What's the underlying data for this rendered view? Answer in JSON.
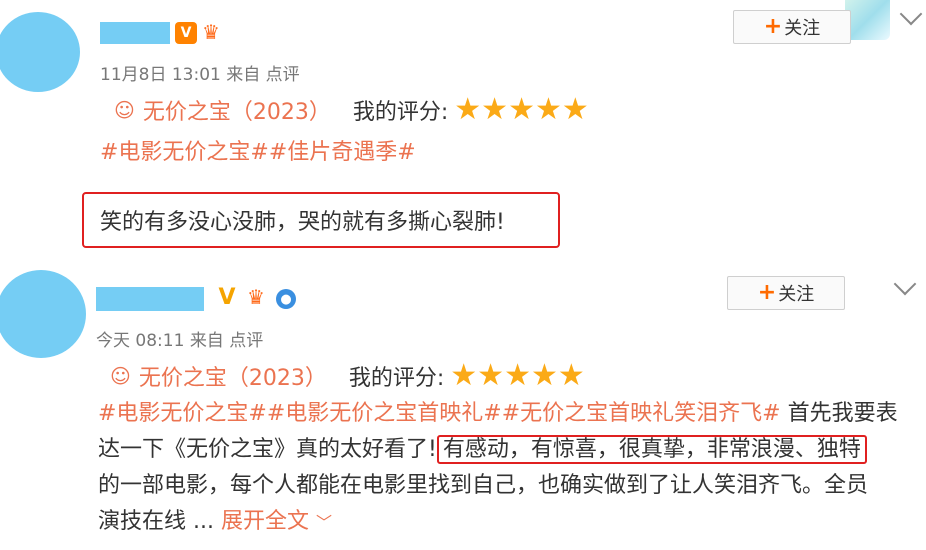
{
  "posts": [
    {
      "timestamp": "11月8日 13:01",
      "source": "来自 点评",
      "follow_label": "关注",
      "follow_plus": "+",
      "movie_title": "无价之宝（2023）",
      "rating_label": "我的评分:",
      "stars": "★★★★★",
      "stars_value": 5,
      "hashtags": "#电影无价之宝##佳片奇遇季#",
      "quote": "笑的有多没心没肺，哭的就有多撕心裂肺!"
    },
    {
      "timestamp": "今天 08:11",
      "source": "来自 点评",
      "follow_label": "关注",
      "follow_plus": "+",
      "movie_title": "无价之宝（2023）",
      "rating_label": "我的评分:",
      "stars": "★★★★★",
      "stars_value": 5,
      "hashtags": "#电影无价之宝##电影无价之宝首映礼##无价之宝首映礼笑泪齐飞#",
      "body_line1_after_tags": " 首先我要表",
      "body_line2_before_hl": "达一下《无价之宝》真的太好看了!",
      "body_highlight": "有感动，有惊喜，很真挚，非常浪漫、独特",
      "body_line3": "的一部电影，每个人都能在电影里找到自己，也确实做到了让人笑泪齐飞。全员",
      "body_line4": "演技在线 ... ",
      "expand_label": "展开全文",
      "expand_icon": "﹀"
    }
  ],
  "icons": {
    "movie_icon": "☺",
    "verified_icon": "V",
    "crown_icon": "♛",
    "globe_icon": "●"
  },
  "colors": {
    "accent": "#eb7350",
    "star": "#fbaa17",
    "highlight_border": "#e02020",
    "avatar": "#75cdf4",
    "follow_plus": "#ff6a00"
  }
}
